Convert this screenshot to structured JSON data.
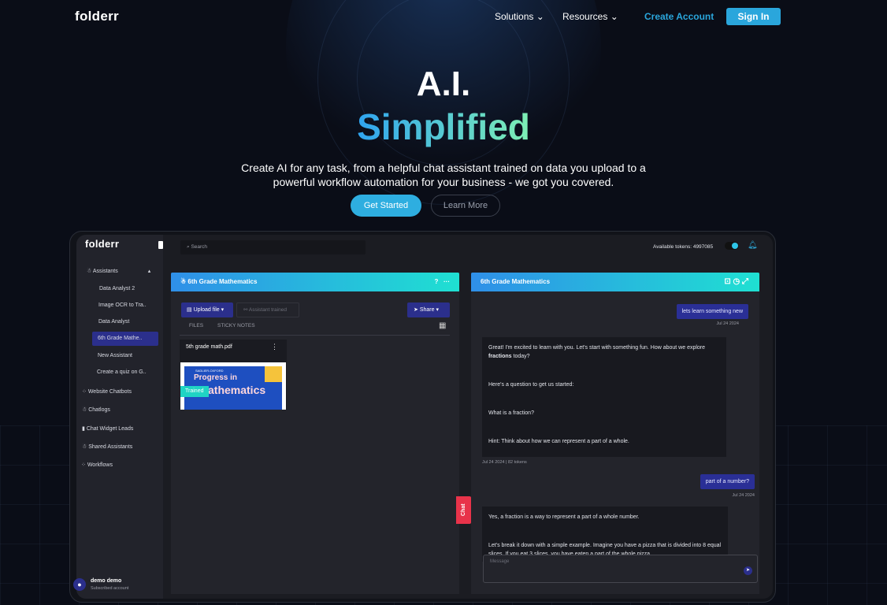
{
  "nav": {
    "logo": "folderr",
    "solutions": "Solutions",
    "resources": "Resources",
    "create_account": "Create Account",
    "sign_in": "Sign In"
  },
  "hero": {
    "title1": "A.I.",
    "title2": "Simplified",
    "subtitle1": "Create AI for any task, from a helpful chat assistant trained on data you upload to a",
    "subtitle2": "powerful workflow automation for your business - we got you covered.",
    "get_started": "Get Started",
    "learn_more": "Learn More"
  },
  "colors": {
    "accent": "#2eaee0",
    "gradient_start": "#2f8fe8",
    "gradient_end": "#1fe0d2",
    "active": "#2b2f8c",
    "chat_tab": "#e8334a"
  },
  "app": {
    "logo": "folderr",
    "search_placeholder": "Search",
    "tokens": "Available tokens: 4997085",
    "sidebar": {
      "assistants": "Assistants",
      "sub": [
        "Data Analyst 2",
        "Image OCR to Tra..",
        "Data Analyst",
        "6th Grade Mathe..",
        "New Assistant",
        "Create a quiz on G.."
      ],
      "items": [
        "Website Chatbots",
        "Chatlogs",
        "Chat Widget Leads",
        "Shared Assistants",
        "Workflows"
      ],
      "user_name": "demo demo",
      "user_status": "Subscribed account"
    },
    "left": {
      "title": "6th Grade Mathematics",
      "upload": "Upload file",
      "trained": "Assistant trained",
      "share": "Share",
      "tabs": [
        "FILES",
        "STICKY NOTES"
      ],
      "file_name": "5th grade math.pdf",
      "cover_top": "SADLIER-OXFORD",
      "cover_title1": "Progress in",
      "cover_title2": "athematics",
      "trained_badge": "Trained"
    },
    "chat_tab": "Chat",
    "right": {
      "title": "6th Grade Mathematics",
      "msg1": "lets learn something new",
      "date1": "Jul 24 2024",
      "a1_line1a": "Great! I'm excited to learn with you. Let's start with something fun. How about we explore ",
      "a1_bold": "fractions",
      "a1_line1b": " today?",
      "a1_p2": "Here's a question to get us started:",
      "a1_p3": "What is a fraction?",
      "a1_p4": "Hint: Think about how we can represent a part of a whole.",
      "a1_meta": "Jul 24 2024 | 82 tokens",
      "msg2": "part of a number?",
      "date2": "Jul 24 2024",
      "a2_p1": "Yes, a fraction is a way to represent a part of a whole number.",
      "a2_p2": "Let's break it down with a simple example. Imagine you have a pizza that is divided into 8 equal slices. If you eat 3 slices, you have eaten a part of the whole pizza.",
      "message_placeholder": "Message"
    }
  }
}
